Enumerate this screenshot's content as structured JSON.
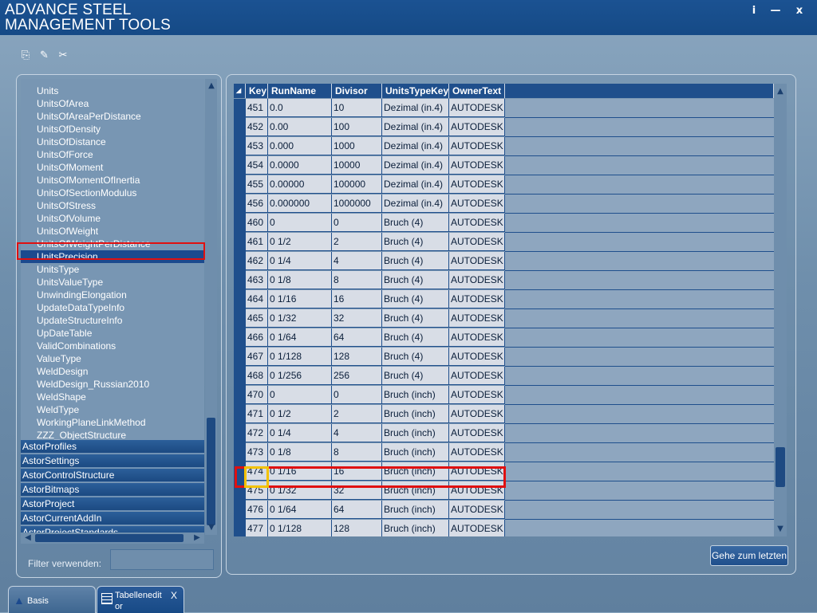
{
  "app": {
    "title_line1": "ADVANCE STEEL",
    "title_line2": "MANAGEMENT TOOLS",
    "window_buttons": {
      "info": "i",
      "minimize": "—",
      "close": "x"
    }
  },
  "toolbar": {
    "icons": [
      "export-icon",
      "list-edit-icon",
      "tools-icon"
    ]
  },
  "tree": {
    "items": [
      "Units",
      "UnitsOfArea",
      "UnitsOfAreaPerDistance",
      "UnitsOfDensity",
      "UnitsOfDistance",
      "UnitsOfForce",
      "UnitsOfMoment",
      "UnitsOfMomentOfInertia",
      "UnitsOfSectionModulus",
      "UnitsOfStress",
      "UnitsOfVolume",
      "UnitsOfWeight",
      "UnitsOfWeightPerDistance",
      "UnitsPrecision",
      "UnitsType",
      "UnitsValueType",
      "UnwindingElongation",
      "UpdateDataTypeInfo",
      "UpdateStructureInfo",
      "UpDateTable",
      "ValidCombinations",
      "ValueType",
      "WeldDesign",
      "WeldDesign_Russian2010",
      "WeldShape",
      "WeldType",
      "WorkingPlaneLinkMethod",
      "ZZZ_ObjectStructure"
    ],
    "selected": "UnitsPrecision",
    "groups": [
      "AstorProfiles",
      "AstorSettings",
      "AstorControlStructure",
      "AstorBitmaps",
      "AstorProject",
      "AstorCurrentAddIn",
      "AstorProjectStandards"
    ]
  },
  "filter": {
    "label": "Filter verwenden:",
    "value": ""
  },
  "grid": {
    "columns": [
      "Key",
      "RunName",
      "Divisor",
      "UnitsTypeKey",
      "OwnerText"
    ],
    "rows": [
      [
        "451",
        "0.0",
        "10",
        "Dezimal (in.4)",
        "AUTODESK"
      ],
      [
        "452",
        "0.00",
        "100",
        "Dezimal (in.4)",
        "AUTODESK"
      ],
      [
        "453",
        "0.000",
        "1000",
        "Dezimal (in.4)",
        "AUTODESK"
      ],
      [
        "454",
        "0.0000",
        "10000",
        "Dezimal (in.4)",
        "AUTODESK"
      ],
      [
        "455",
        "0.00000",
        "100000",
        "Dezimal (in.4)",
        "AUTODESK"
      ],
      [
        "456",
        "0.000000",
        "1000000",
        "Dezimal (in.4)",
        "AUTODESK"
      ],
      [
        "460",
        "0",
        "0",
        "Bruch (4)",
        "AUTODESK"
      ],
      [
        "461",
        "0 1/2",
        "2",
        "Bruch (4)",
        "AUTODESK"
      ],
      [
        "462",
        "0 1/4",
        "4",
        "Bruch (4)",
        "AUTODESK"
      ],
      [
        "463",
        "0 1/8",
        "8",
        "Bruch (4)",
        "AUTODESK"
      ],
      [
        "464",
        "0 1/16",
        "16",
        "Bruch (4)",
        "AUTODESK"
      ],
      [
        "465",
        "0 1/32",
        "32",
        "Bruch (4)",
        "AUTODESK"
      ],
      [
        "466",
        "0 1/64",
        "64",
        "Bruch (4)",
        "AUTODESK"
      ],
      [
        "467",
        "0 1/128",
        "128",
        "Bruch (4)",
        "AUTODESK"
      ],
      [
        "468",
        "0 1/256",
        "256",
        "Bruch (4)",
        "AUTODESK"
      ],
      [
        "470",
        "0",
        "0",
        "Bruch (inch)",
        "AUTODESK"
      ],
      [
        "471",
        "0 1/2",
        "2",
        "Bruch (inch)",
        "AUTODESK"
      ],
      [
        "472",
        "0 1/4",
        "4",
        "Bruch (inch)",
        "AUTODESK"
      ],
      [
        "473",
        "0 1/8",
        "8",
        "Bruch (inch)",
        "AUTODESK"
      ],
      [
        "474",
        "0 1/16",
        "16",
        "Bruch (inch)",
        "AUTODESK"
      ],
      [
        "475",
        "0 1/32",
        "32",
        "Bruch (inch)",
        "AUTODESK"
      ],
      [
        "476",
        "0 1/64",
        "64",
        "Bruch (inch)",
        "AUTODESK"
      ],
      [
        "477",
        "0 1/128",
        "128",
        "Bruch (inch)",
        "AUTODESK"
      ]
    ],
    "highlighted_key": "474",
    "go_last_label": "Gehe zum letzten"
  },
  "tabs": [
    {
      "label": "Basis",
      "icon": "autodesk-logo-icon"
    },
    {
      "label_line1": "Tabellenedit",
      "label_line2": "or",
      "icon": "table-icon",
      "close": "X"
    }
  ],
  "colors": {
    "title_bar": "#154a86",
    "selection": "#1c4a8e",
    "highlight_red": "#e01010",
    "highlight_yellow": "#f2c200"
  }
}
